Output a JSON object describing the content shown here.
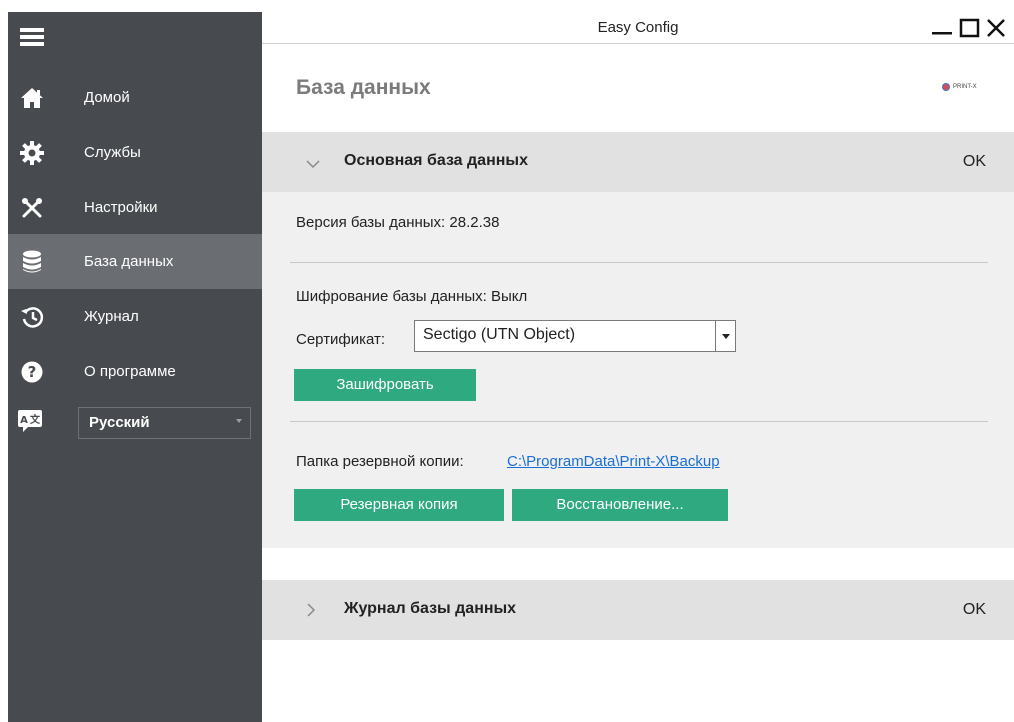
{
  "window": {
    "title": "Easy Config"
  },
  "sidebar": {
    "items": [
      {
        "label": "Домой",
        "icon": "home-icon"
      },
      {
        "label": "Службы",
        "icon": "gear-icon"
      },
      {
        "label": "Настройки",
        "icon": "tools-icon"
      },
      {
        "label": "База данных",
        "icon": "database-icon",
        "active": true
      },
      {
        "label": "Журнал",
        "icon": "history-icon"
      },
      {
        "label": "О программе",
        "icon": "help-icon"
      }
    ],
    "language": {
      "icon": "language-icon",
      "selected": "Русский"
    }
  },
  "main": {
    "page_title": "База данных",
    "logo_text": "PRINT-X",
    "sections": [
      {
        "title": "Основная база данных",
        "status": "OK",
        "expanded": true
      },
      {
        "title": "Журнал базы данных",
        "status": "OK",
        "expanded": false
      }
    ],
    "db": {
      "version_text": "Версия базы данных: 28.2.38",
      "encryption_text": "Шифрование базы данных: Выкл",
      "certificate_label": "Сертификат:",
      "certificate_value": "Sectigo (UTN Object)",
      "encrypt_button": "Зашифровать",
      "backup_folder_label": "Папка резервной копии:",
      "backup_folder_path": "C:\\ProgramData\\Print-X\\Backup",
      "backup_button": "Резервная копия",
      "restore_button": "Восстановление..."
    }
  },
  "colors": {
    "sidebar_bg": "#474a4f",
    "sidebar_active": "#6a6d72",
    "accent_green": "#2fa980",
    "panel_header": "#e1e1e1",
    "panel_body": "#f0f0f0",
    "link": "#1a6fd6"
  }
}
